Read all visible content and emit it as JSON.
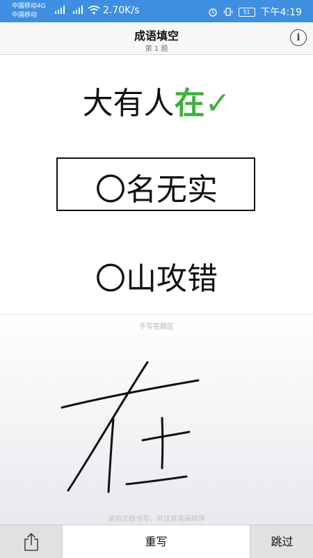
{
  "status_bar": {
    "carrier1": "中国移动4G",
    "carrier2": "中国移动",
    "speed": "2.70K/s",
    "battery": "51",
    "time": "下午4:19"
  },
  "nav": {
    "title": "成语填空",
    "subtitle": "第 1 题",
    "info_icon": "i"
  },
  "idioms": [
    {
      "prefix": "大有人",
      "answer": "在",
      "check": "✓"
    },
    {
      "circle": "〇",
      "rest": "名无实"
    },
    {
      "circle": "〇",
      "rest": "山攻错"
    }
  ],
  "handwriting": {
    "title": "手写答题区",
    "hint": "请用正楷书写，并注意笔画顺序"
  },
  "toolbar": {
    "rewrite_label": "重写",
    "skip_label": "跳过"
  },
  "colors": {
    "status_bar": "#3f8fe0",
    "correct": "#3db13d"
  }
}
